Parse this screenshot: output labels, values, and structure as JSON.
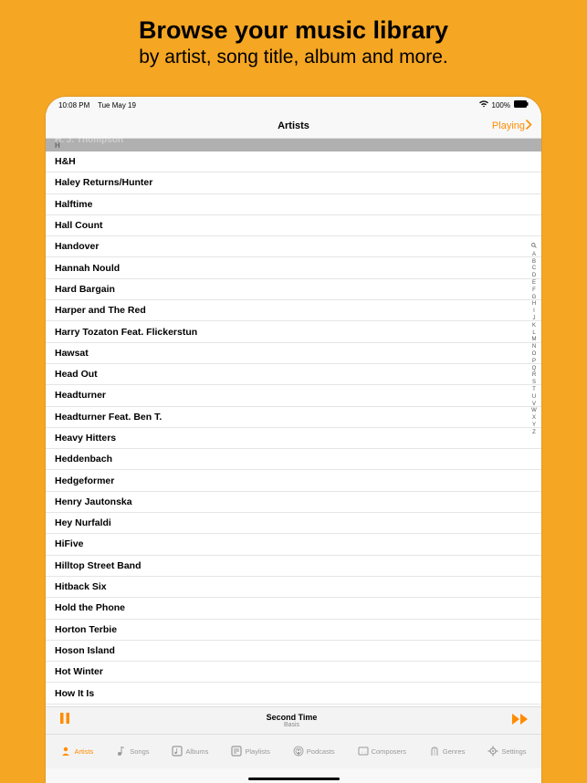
{
  "promo": {
    "title": "Browse your music library",
    "subtitle": "by artist, song title, album and more."
  },
  "statusbar": {
    "time": "10:08 PM",
    "date": "Tue May 19",
    "battery": "100%"
  },
  "navbar": {
    "title": "Artists",
    "playing": "Playing"
  },
  "faded_prev": "H. J. Thompson",
  "section_letter": "H",
  "artists": [
    "H&H",
    "Haley Returns/Hunter",
    "Halftime",
    "Hall Count",
    "Handover",
    "Hannah Nould",
    "Hard Bargain",
    "Harper and The Red",
    "Harry Tozaton Feat. Flickerstun",
    "Hawsat",
    "Head Out",
    "Headturner",
    "Headturner Feat. Ben T.",
    "Heavy Hitters",
    "Heddenbach",
    "Hedgeformer",
    "Henry Jautonska",
    "Hey Nurfaldi",
    "HiFive",
    "Hilltop Street Band",
    "Hitback Six",
    "Hold the Phone",
    "Horton Terbie",
    "Hoson Island",
    "Hot Winter",
    "How It Is"
  ],
  "index_letters": [
    "A",
    "B",
    "C",
    "D",
    "E",
    "F",
    "G",
    "H",
    "I",
    "J",
    "K",
    "L",
    "M",
    "N",
    "O",
    "P",
    "Q",
    "R",
    "S",
    "T",
    "U",
    "V",
    "W",
    "X",
    "Y",
    "Z"
  ],
  "nowplaying": {
    "title": "Second Time",
    "artist": "Basis"
  },
  "tabs": [
    {
      "label": "Artists"
    },
    {
      "label": "Songs"
    },
    {
      "label": "Albums"
    },
    {
      "label": "Playlists"
    },
    {
      "label": "Podcasts"
    },
    {
      "label": "Composers"
    },
    {
      "label": "Genres"
    },
    {
      "label": "Settings"
    }
  ]
}
